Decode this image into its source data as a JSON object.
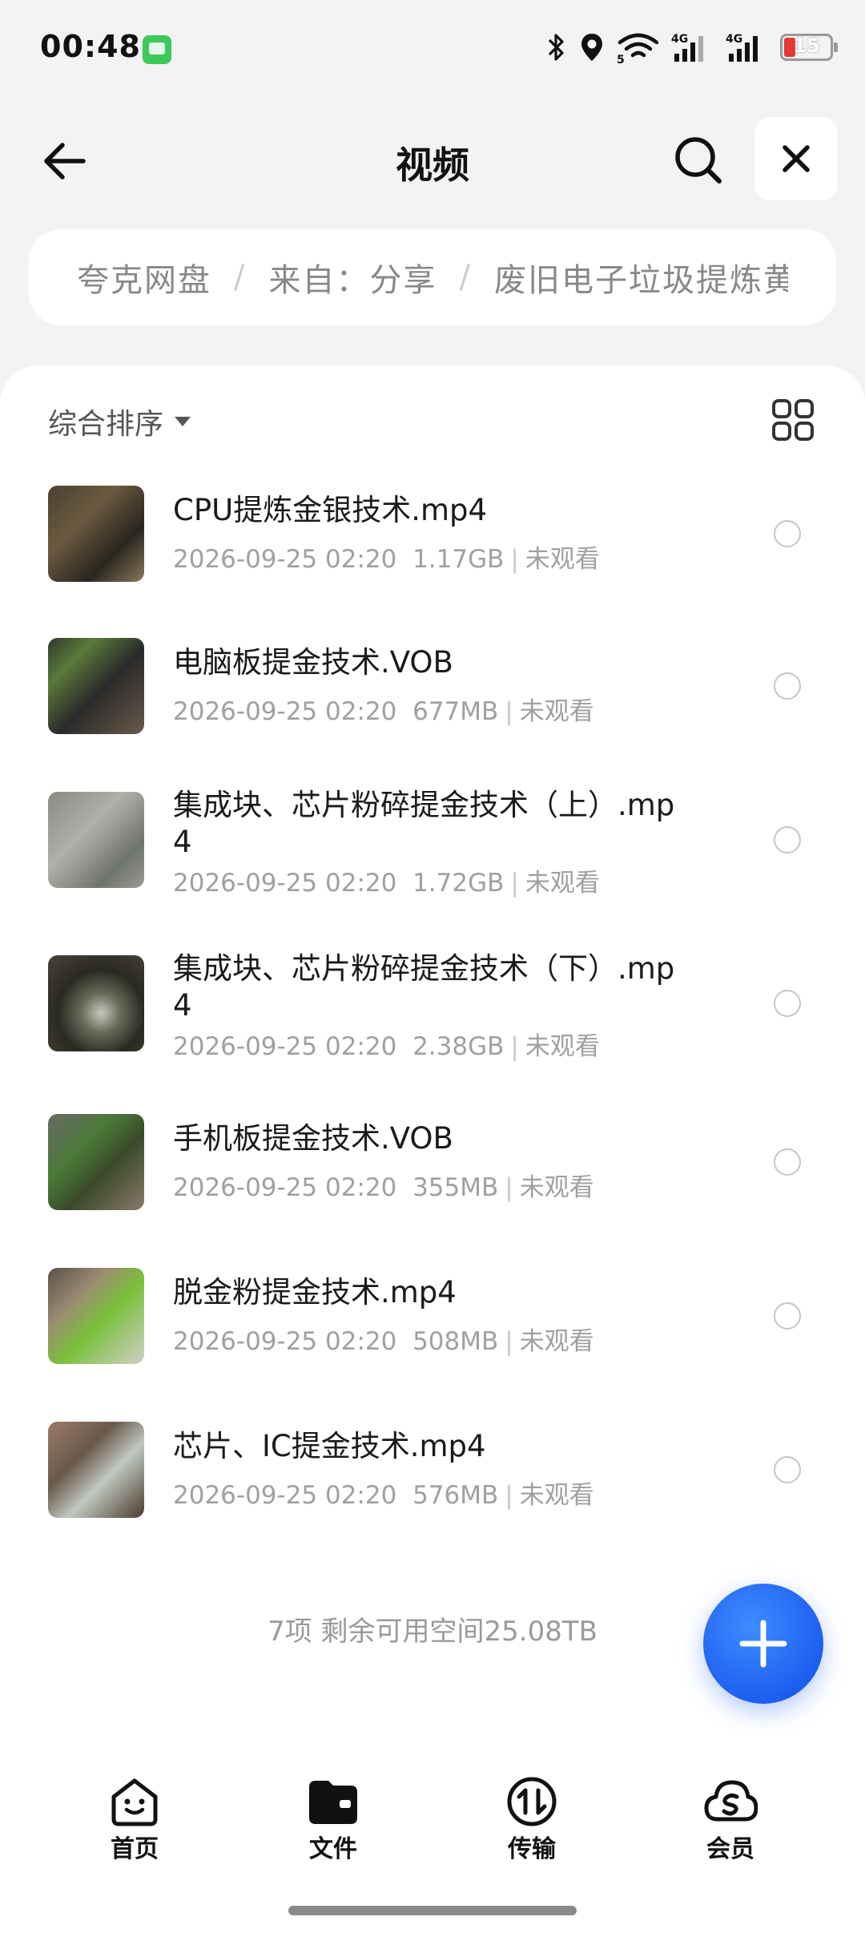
{
  "status_bar": {
    "time": "00:48",
    "battery": "15",
    "icons": [
      "app-notification-icon",
      "bluetooth-icon",
      "location-icon",
      "wifi-icon",
      "signal-4g-icon",
      "signal-4g-icon",
      "battery-icon"
    ]
  },
  "header": {
    "title": "视频",
    "back_icon": "arrow-left-icon",
    "search_icon": "search-icon",
    "close_icon": "close-icon"
  },
  "breadcrumb": {
    "items": [
      "夸克网盘",
      "来自：分享",
      "废旧电子垃圾提炼黄金"
    ],
    "separator": "/"
  },
  "toolbar": {
    "sort_label": "综合排序",
    "view_toggle_icon": "grid-view-icon"
  },
  "files": [
    {
      "name": "CPU提炼金银技术.mp4",
      "date": "2026-09-25 02:20",
      "size": "1.17GB",
      "status": "未观看"
    },
    {
      "name": "电脑板提金技术.VOB",
      "date": "2026-09-25 02:20",
      "size": "677MB",
      "status": "未观看"
    },
    {
      "name": "集成块、芯片粉碎提金技术（上）.mp4",
      "date": "2026-09-25 02:20",
      "size": "1.72GB",
      "status": "未观看"
    },
    {
      "name": "集成块、芯片粉碎提金技术（下）.mp4",
      "date": "2026-09-25 02:20",
      "size": "2.38GB",
      "status": "未观看"
    },
    {
      "name": "手机板提金技术.VOB",
      "date": "2026-09-25 02:20",
      "size": "355MB",
      "status": "未观看"
    },
    {
      "name": "脱金粉提金技术.mp4",
      "date": "2026-09-25 02:20",
      "size": "508MB",
      "status": "未观看"
    },
    {
      "name": "芯片、IC提金技术.mp4",
      "date": "2026-09-25 02:20",
      "size": "576MB",
      "status": "未观看"
    }
  ],
  "footer": {
    "summary": "7项 剩余可用空间25.08TB"
  },
  "fab": {
    "icon": "plus-icon",
    "color": "#1d5ff0"
  },
  "tabs": [
    {
      "label": "首页",
      "icon": "home-smile-icon"
    },
    {
      "label": "文件",
      "icon": "folder-icon"
    },
    {
      "label": "传输",
      "icon": "transfer-icon"
    },
    {
      "label": "会员",
      "icon": "cloud-member-icon"
    }
  ]
}
